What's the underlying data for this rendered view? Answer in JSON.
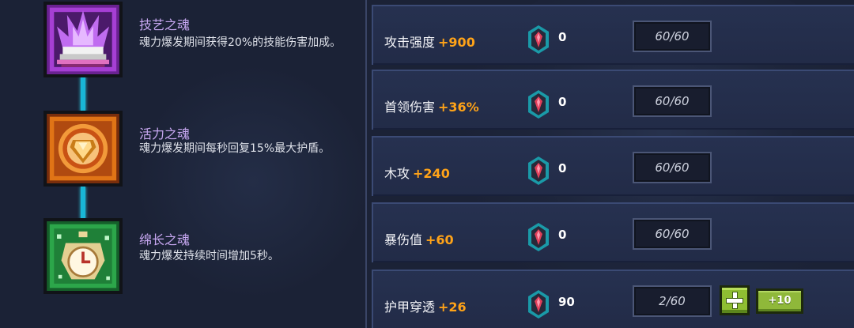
{
  "souls": [
    {
      "name": "技艺之魂",
      "desc": "魂力爆发期间获得20%的技能伤害加成。",
      "icon": "purple-flame-book-icon",
      "frame_color": "#9d38c9"
    },
    {
      "name": "活力之魂",
      "desc": "魂力爆发期间每秒回复15%最大护盾。",
      "icon": "orange-shield-gem-icon",
      "frame_color": "#e07416"
    },
    {
      "name": "绵长之魂",
      "desc": "魂力爆发持续时间增加5秒。",
      "icon": "green-pocket-watch-icon",
      "frame_color": "#2ca64a"
    }
  ],
  "stats": [
    {
      "label": "攻击强度",
      "bonus": "+900",
      "gem_count": "0",
      "level": "60/60",
      "upgradable": false
    },
    {
      "label": "首领伤害",
      "bonus": "+36%",
      "gem_count": "0",
      "level": "60/60",
      "upgradable": false
    },
    {
      "label": "木攻",
      "bonus": "+240",
      "gem_count": "0",
      "level": "60/60",
      "upgradable": false
    },
    {
      "label": "暴伤值",
      "bonus": "+60",
      "gem_count": "0",
      "level": "60/60",
      "upgradable": false
    },
    {
      "label": "护甲穿透",
      "bonus": "+26",
      "gem_count": "90",
      "level": "2/60",
      "upgradable": true,
      "plus_label": "+10"
    }
  ],
  "colors": {
    "bonus": "#ffa318",
    "connector": "#19b6d6",
    "soul_name": "#c8a8f2",
    "upgrade_green": "#8fbe32"
  },
  "gem_icon": "soul-crystal-icon",
  "plus_icon": "plus-icon"
}
